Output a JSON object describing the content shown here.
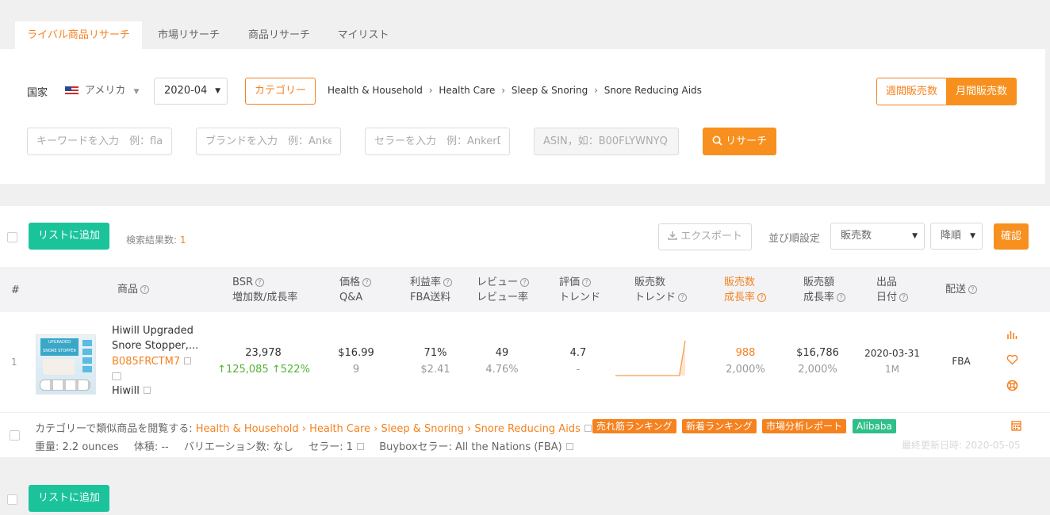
{
  "tabs": [
    {
      "label": "ライバル商品リサーチ",
      "active": true
    },
    {
      "label": "市場リサーチ"
    },
    {
      "label": "商品リサーチ"
    },
    {
      "label": "マイリスト"
    }
  ],
  "filters": {
    "country_label": "国家",
    "country_value": "アメリカ",
    "month_value": "2020-04",
    "category_button": "カテゴリー",
    "breadcrumb": [
      "Health & Household",
      "Health Care",
      "Sleep & Snoring",
      "Snore Reducing Aids"
    ],
    "breadcrumb_sep": "›",
    "toggle_weekly": "週間販売数",
    "toggle_monthly": "月間販売数",
    "keyword_placeholder": "キーワードを入力　例：flashlight",
    "brand_placeholder": "ブランドを入力　例：Anker",
    "seller_placeholder": "セラーを入力　例：AnkerDirect",
    "asin_placeholder": "ASIN，如：B00FLYWNYQ",
    "search_button": "リサーチ"
  },
  "toolbar": {
    "add_to_list": "リストに追加",
    "result_label": "検索結果数:",
    "result_count": "1",
    "export": "エクスポート",
    "sort_label": "並び順設定",
    "sort_value": "販売数",
    "order_value": "降順",
    "confirm": "確認"
  },
  "table": {
    "headers": {
      "index": "#",
      "product": "商品",
      "bsr_1": "BSR",
      "bsr_2": "増加数/成長率",
      "price_1": "価格",
      "price_2": "Q&A",
      "margin_1": "利益率",
      "margin_2": "FBA送料",
      "review_1": "レビュー",
      "review_2": "レビュー率",
      "rating_1": "評価",
      "rating_2": "トレンド",
      "sales_trend_1": "販売数",
      "sales_trend_2": "トレンド",
      "sales_growth_1": "販売数",
      "sales_growth_2": "成長率",
      "revenue_1": "販売額",
      "revenue_2": "成長率",
      "listing_1": "出品",
      "listing_2": "日付",
      "shipping": "配送"
    },
    "row": {
      "index": "1",
      "image_text_1": "UPGRADED",
      "image_text_2": "SNORE STOPPER",
      "title_line1": "Hiwill Upgraded",
      "title_line2": "Snore Stopper,...",
      "asin": "B085FRCTM7",
      "brand": "Hiwill",
      "bsr": "23,978",
      "bsr_increase": "↑125,085",
      "bsr_rate": "↑522%",
      "price": "$16.99",
      "qa": "9",
      "margin": "71%",
      "fba_fee": "$2.41",
      "reviews": "49",
      "review_rate": "4.76%",
      "rating": "4.7",
      "rating_trend": "-",
      "sales": "988",
      "sales_growth": "2,000%",
      "revenue": "$16,786",
      "revenue_growth": "2,000%",
      "listing_date": "2020-03-31",
      "listing_age": "1M",
      "shipping": "FBA",
      "sales_trend": [
        0,
        0,
        0,
        0,
        0,
        0,
        0,
        0,
        0,
        0,
        0,
        0,
        1
      ]
    },
    "detail": {
      "similar_label": "カテゴリーで類似商品を閲覧する:",
      "path": "Health & Household › Health Care › Sleep & Snoring › Snore Reducing Aids",
      "badges": [
        "売れ筋ランキング",
        "新着ランキング",
        "市場分析レポート",
        "Alibaba"
      ],
      "badge_colors": [
        "#f5821f",
        "#f5821f",
        "#f5821f",
        "#2fbf88"
      ],
      "weight": "重量: 2.2 ounces",
      "volume": "体積: --",
      "variations": "バリエーション数: なし",
      "sellers": "セラー: 1",
      "buybox": "Buyboxセラー:  All the Nations  (FBA)",
      "updated": "最終更新日時: 2020-05-05"
    }
  },
  "bottom": {
    "add_to_list": "リストに追加"
  },
  "colors": {
    "accent": "#f5821f",
    "green": "#1bc39b"
  }
}
